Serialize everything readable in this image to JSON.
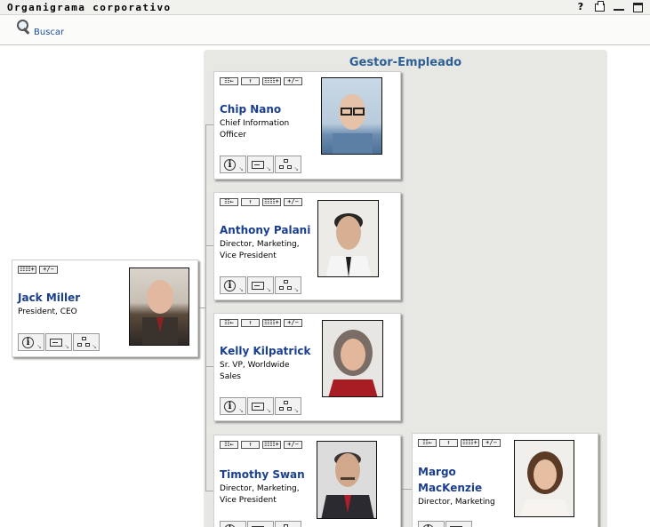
{
  "window": {
    "title": "Organigrama corporativo",
    "help_icon": "?"
  },
  "toolbar": {
    "search_label": "Buscar"
  },
  "panel": {
    "title": "Gestor-Empleado"
  },
  "root": {
    "name": "Jack Miller",
    "title_line1": "President, CEO",
    "actions": [
      "☷☷+",
      "+/−"
    ]
  },
  "reports": [
    {
      "name": "Chip Nano",
      "title_line1": "Chief Information",
      "title_line2": "Officer"
    },
    {
      "name": "Anthony Palani",
      "title_line1": "Director, Marketing,",
      "title_line2": "Vice President"
    },
    {
      "name": "Kelly Kilpatrick",
      "title_line1": "Sr. VP, Worldwide",
      "title_line2": "Sales"
    },
    {
      "name": "Timothy Swan",
      "title_line1": "Director, Marketing,",
      "title_line2": "Vice President"
    }
  ],
  "sub_report": {
    "name_line1": "Margo",
    "name_line2": "MacKenzie",
    "title_line1": "Director, Marketing"
  },
  "action_labels": {
    "goto": "☷←",
    "up": "↑",
    "expand": "☷☷+",
    "toggle": "+/−"
  },
  "bottom_buttons": {
    "info": "i"
  },
  "colors": {
    "name": "#1b3f8f",
    "panel_title": "#2d5f95",
    "panel_bg": "#e7e7e4"
  }
}
